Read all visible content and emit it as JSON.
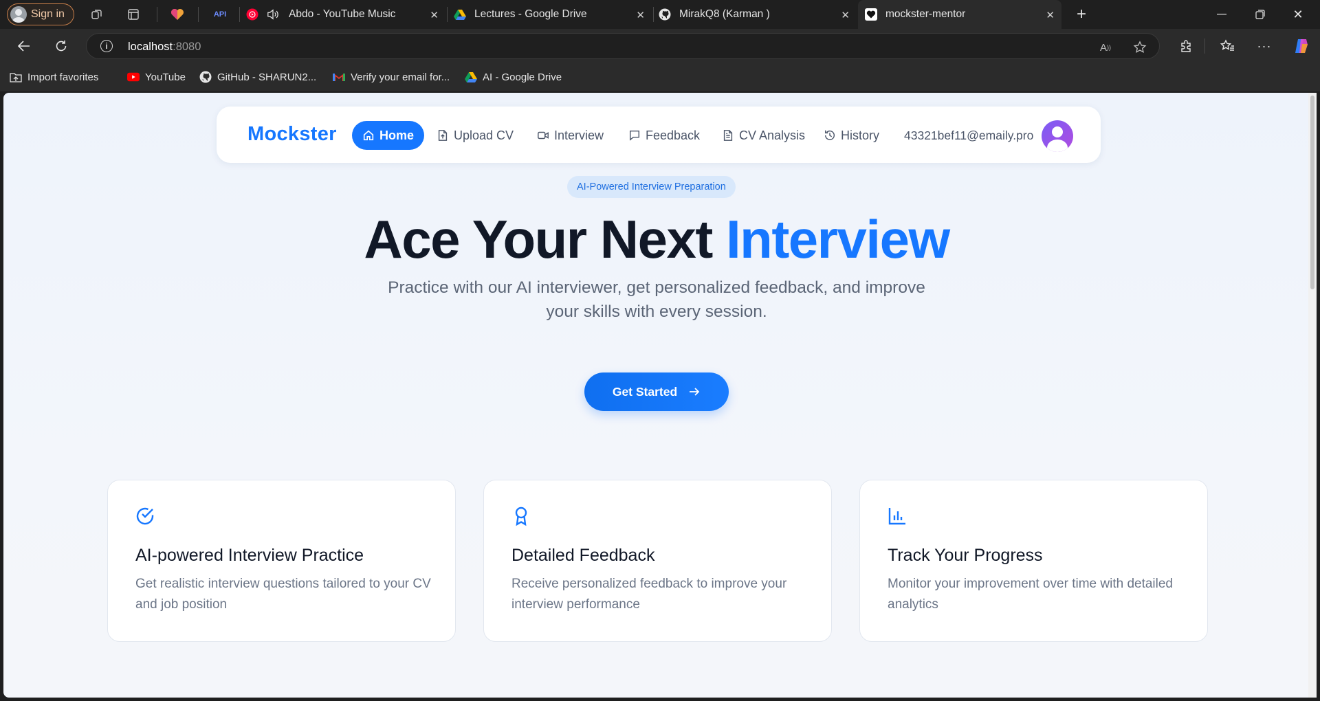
{
  "browser": {
    "signin_label": "Sign in",
    "tabs": [
      {
        "title": "Abdo - YouTube Music",
        "icon": "youtube-music-icon"
      },
      {
        "title": "Lectures - Google Drive",
        "icon": "google-drive-icon"
      },
      {
        "title": "MirakQ8 (Karman )",
        "icon": "github-icon"
      },
      {
        "title": "mockster-mentor",
        "icon": "heart-icon",
        "active": true
      }
    ],
    "address": {
      "host": "localhost",
      "port": ":8080"
    },
    "favorites": [
      {
        "label": "Import favorites",
        "icon": "import-folder-icon"
      },
      {
        "label": "YouTube",
        "icon": "youtube-icon"
      },
      {
        "label": "GitHub - SHARUN2...",
        "icon": "github-icon"
      },
      {
        "label": "Verify your email for...",
        "icon": "gmail-icon"
      },
      {
        "label": "AI - Google Drive",
        "icon": "google-drive-icon"
      }
    ]
  },
  "app": {
    "brand": "Mockster",
    "nav": [
      {
        "label": "Home",
        "icon": "home-icon",
        "active": true
      },
      {
        "label": "Upload CV",
        "icon": "file-upload-icon"
      },
      {
        "label": "Interview",
        "icon": "video-icon"
      },
      {
        "label": "Feedback",
        "icon": "message-icon"
      },
      {
        "label": "CV Analysis",
        "icon": "file-text-icon"
      },
      {
        "label": "History",
        "icon": "history-icon"
      }
    ],
    "user_email": "43321bef11@emaily.pro",
    "hero": {
      "badge": "AI-Powered Interview Preparation",
      "title_main": "Ace Your Next ",
      "title_accent": "Interview",
      "subtitle": "Practice with our AI interviewer, get personalized feedback, and improve your skills with every session.",
      "cta": "Get Started"
    },
    "features": [
      {
        "title": "AI-powered Interview Practice",
        "description": "Get realistic interview questions tailored to your CV and job position",
        "icon": "check-circle-icon"
      },
      {
        "title": "Detailed Feedback",
        "description": "Receive personalized feedback to improve your interview performance",
        "icon": "award-icon"
      },
      {
        "title": "Track Your Progress",
        "description": "Monitor your improvement over time with detailed analytics",
        "icon": "bar-chart-icon"
      }
    ],
    "colors": {
      "accent": "#1677ff",
      "text": "#111827",
      "muted": "#6b7587"
    }
  }
}
